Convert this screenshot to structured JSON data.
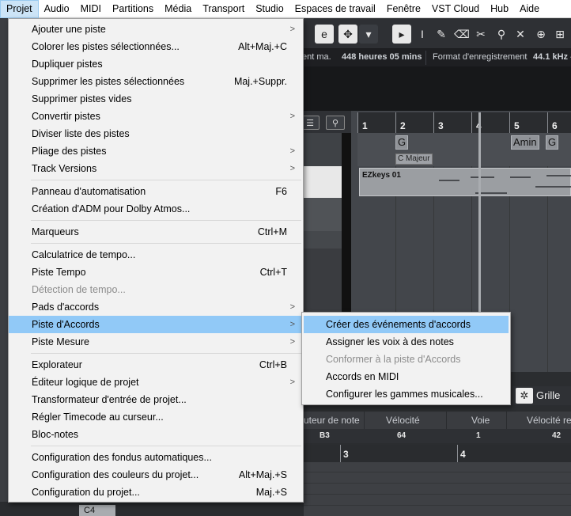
{
  "menubar": {
    "items": [
      "Projet",
      "Audio",
      "MIDI",
      "Partitions",
      "Média",
      "Transport",
      "Studio",
      "Espaces de travail",
      "Fenêtre",
      "VST Cloud",
      "Hub",
      "Aide"
    ]
  },
  "toolbar": {
    "icons": [
      "edit-icon",
      "drag-mode-icon",
      "dropdown-icon",
      "pointer-icon",
      "range-icon",
      "pencil-icon",
      "eraser-icon",
      "split-icon",
      "glue-icon",
      "mute-icon",
      "zoom-icon",
      "mixer-icon"
    ],
    "glyphs": [
      "e",
      "✥",
      "▾",
      "▸",
      "I",
      "✎",
      "⌫",
      "✂",
      "⚲",
      "✕",
      "⊕",
      "⊞"
    ]
  },
  "infobar": {
    "rec_time_label": "ent ma.",
    "rec_time_value": "448 heures 05 mins",
    "format_label": "Format d'enregistrement",
    "format_value": "44.1 kHz -"
  },
  "arranger": {
    "ruler": [
      "1",
      "2",
      "3",
      "4",
      "5",
      "6"
    ],
    "chords": [
      "G",
      "Amin",
      "G"
    ],
    "scale": "C Majeur",
    "event_name": "EZkeys 01"
  },
  "grille": "Grille",
  "midi_editor": {
    "headers": [
      "uteur de note",
      "Vélocité",
      "Voie",
      "Vélocité re"
    ],
    "values": [
      "B3",
      "64",
      "1",
      "42"
    ],
    "ruler": [
      "3",
      "4"
    ],
    "key_label": "C4"
  },
  "menu": {
    "items": [
      {
        "label": "Ajouter une piste",
        "shortcut": "",
        "submenu": true
      },
      {
        "label": "Colorer les pistes sélectionnées...",
        "shortcut": "Alt+Maj.+C",
        "submenu": false
      },
      {
        "label": "Dupliquer pistes",
        "shortcut": "",
        "submenu": false
      },
      {
        "label": "Supprimer les pistes sélectionnées",
        "shortcut": "Maj.+Suppr.",
        "submenu": false
      },
      {
        "label": "Supprimer pistes vides",
        "shortcut": "",
        "submenu": false
      },
      {
        "label": "Convertir pistes",
        "shortcut": "",
        "submenu": true
      },
      {
        "label": "Diviser liste des pistes",
        "shortcut": "",
        "submenu": false
      },
      {
        "label": "Pliage des pistes",
        "shortcut": "",
        "submenu": true
      },
      {
        "label": "Track Versions",
        "shortcut": "",
        "submenu": true
      },
      {
        "label": "Panneau d'automatisation",
        "shortcut": "F6",
        "submenu": false
      },
      {
        "label": "Création d'ADM pour Dolby Atmos...",
        "shortcut": "",
        "submenu": false
      },
      {
        "label": "Marqueurs",
        "shortcut": "Ctrl+M",
        "submenu": false
      },
      {
        "label": "Calculatrice de tempo...",
        "shortcut": "",
        "submenu": false
      },
      {
        "label": "Piste Tempo",
        "shortcut": "Ctrl+T",
        "submenu": false
      },
      {
        "label": "Détection de tempo...",
        "shortcut": "",
        "submenu": false
      },
      {
        "label": "Pads d'accords",
        "shortcut": "",
        "submenu": true
      },
      {
        "label": "Piste d'Accords",
        "shortcut": "",
        "submenu": true
      },
      {
        "label": "Piste Mesure",
        "shortcut": "",
        "submenu": true
      },
      {
        "label": "Explorateur",
        "shortcut": "Ctrl+B",
        "submenu": false
      },
      {
        "label": "Éditeur logique de projet",
        "shortcut": "",
        "submenu": true
      },
      {
        "label": "Transformateur d'entrée de projet...",
        "shortcut": "",
        "submenu": false
      },
      {
        "label": "Régler Timecode au curseur...",
        "shortcut": "",
        "submenu": false
      },
      {
        "label": "Bloc-notes",
        "shortcut": "",
        "submenu": false
      },
      {
        "label": "Configuration des fondus automatiques...",
        "shortcut": "",
        "submenu": false
      },
      {
        "label": "Configuration des couleurs du projet...",
        "shortcut": "Alt+Maj.+S",
        "submenu": false
      },
      {
        "label": "Configuration du projet...",
        "shortcut": "Maj.+S",
        "submenu": false
      }
    ]
  },
  "submenu": {
    "items": [
      {
        "label": "Créer des événements d'accords"
      },
      {
        "label": "Assigner les voix à des notes"
      },
      {
        "label": "Conformer à la piste d'Accords"
      },
      {
        "label": "Accords en MIDI"
      },
      {
        "label": "Configurer les gammes musicales..."
      }
    ]
  }
}
